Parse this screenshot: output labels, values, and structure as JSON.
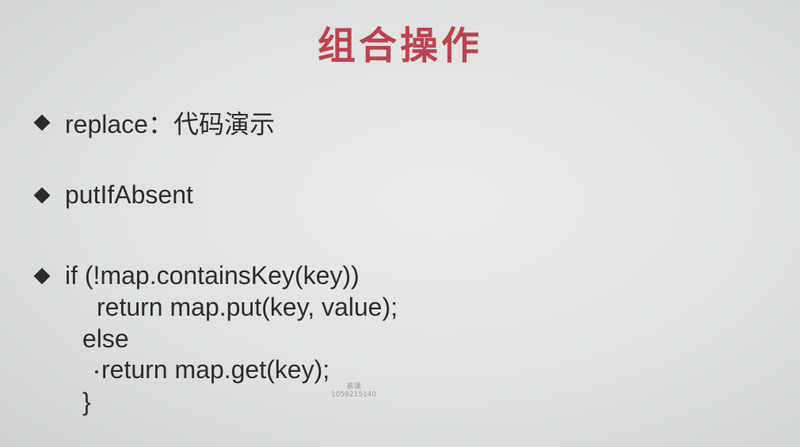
{
  "slide": {
    "title": "组合操作",
    "bullets": [
      {
        "text": "replace：代码演示"
      },
      {
        "text": "putIfAbsent"
      },
      {
        "text": "if (!map.containsKey(key))"
      }
    ],
    "code_lines": [
      "return map.put(key, value);",
      "else",
      "return map.get(key);",
      "}"
    ],
    "watermark": {
      "line1": "慕课",
      "line2": "1059215140"
    },
    "colors": {
      "title": "#c0414e",
      "text": "#2c2c2c",
      "background": "#e2e5e4"
    }
  }
}
